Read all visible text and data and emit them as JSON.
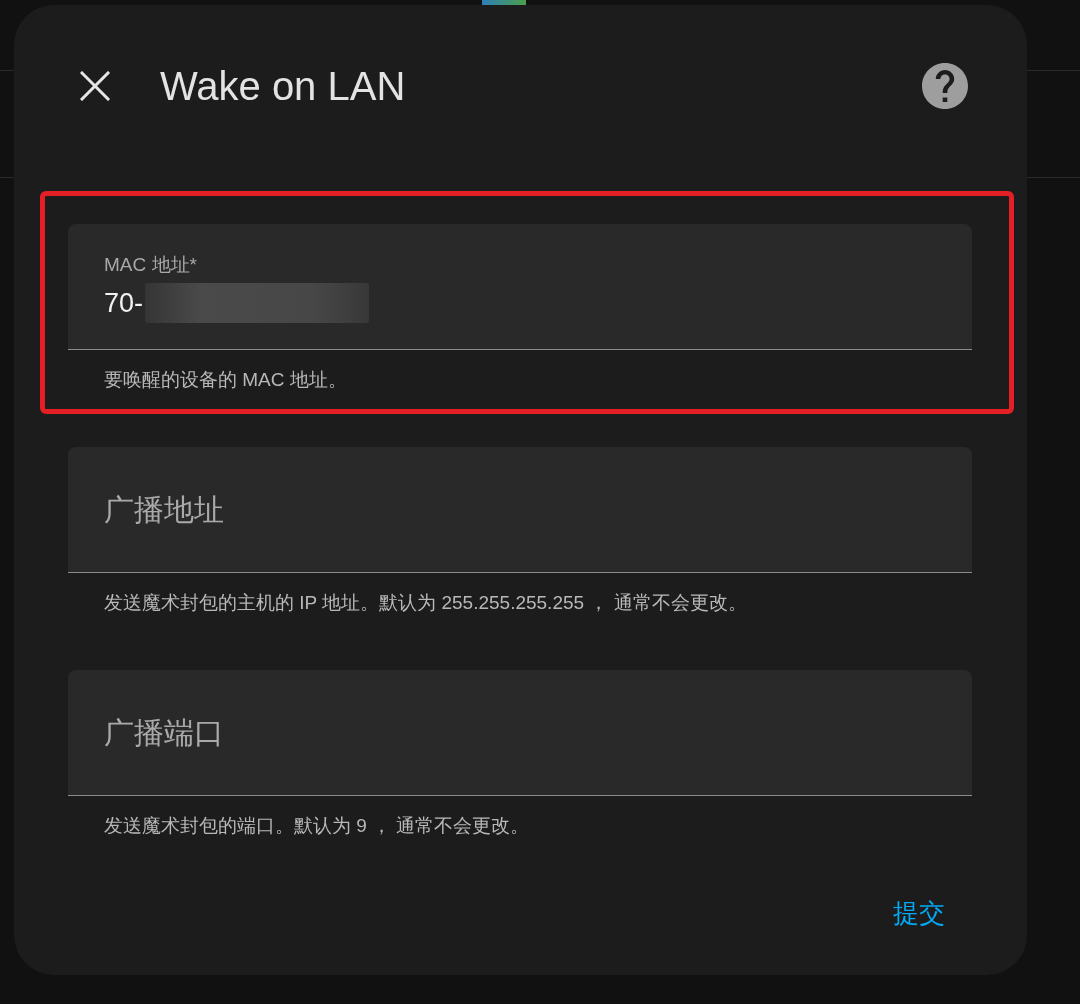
{
  "dialog": {
    "title": "Wake on LAN"
  },
  "fields": [
    {
      "label": "MAC 地址*",
      "value": "70-",
      "value_redacted": true,
      "highlighted": true,
      "helper": "要唤醒的设备的 MAC 地址。"
    },
    {
      "label": "广播地址",
      "value_redacted": false,
      "highlighted": false,
      "helper": "发送魔术封包的主机的 IP 地址。默认为 255.255.255.255 ， 通常不会更改。"
    },
    {
      "label": "广播端口",
      "value_redacted": false,
      "highlighted": false,
      "helper": "发送魔术封包的端口。默认为 9 ， 通常不会更改。"
    }
  ],
  "submit": {
    "label": "提交"
  }
}
